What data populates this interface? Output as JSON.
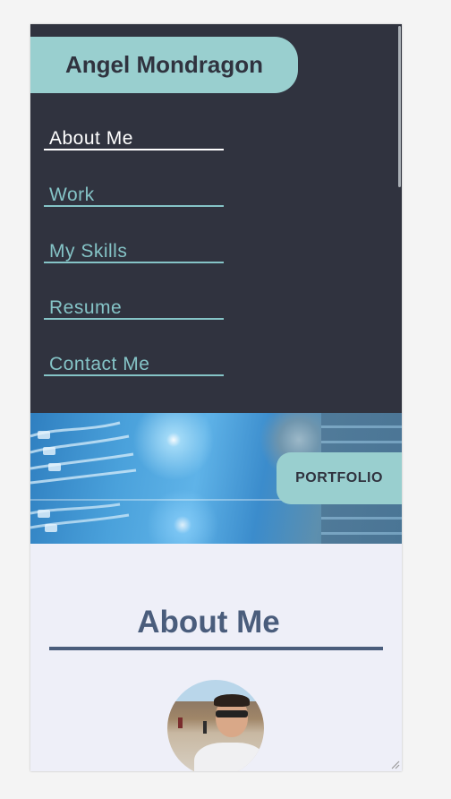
{
  "brand": {
    "name": "Angel Mondragon"
  },
  "nav": {
    "items": [
      {
        "label": "About Me",
        "active": true
      },
      {
        "label": "Work",
        "active": false
      },
      {
        "label": "My Skills",
        "active": false
      },
      {
        "label": "Resume",
        "active": false
      },
      {
        "label": "Contact Me",
        "active": false
      }
    ]
  },
  "banner": {
    "tag": "PORTFOLIO"
  },
  "about": {
    "heading": "About Me"
  },
  "colors": {
    "nav_bg": "#30333f",
    "accent": "#99cfcf",
    "link": "#85c4c7",
    "heading": "#4a5d7c",
    "page_bg": "#eeeff8"
  },
  "icons": {
    "resize": "resize-grip-icon",
    "scrollbar": "scrollbar-thumb"
  }
}
